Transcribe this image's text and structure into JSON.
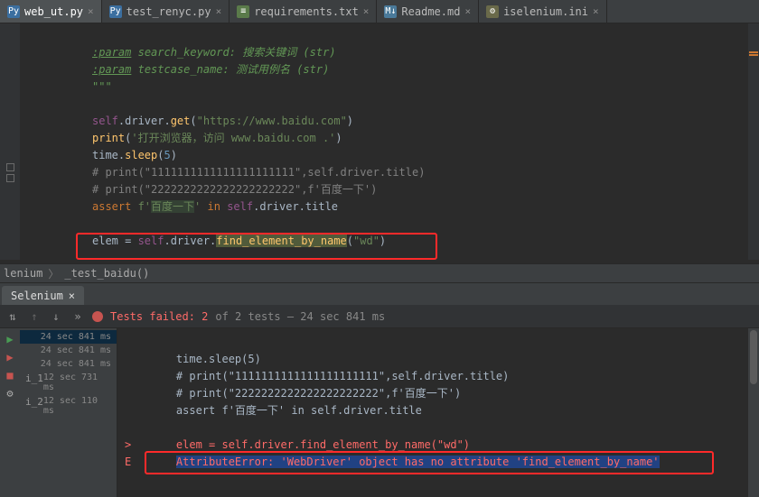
{
  "tabs": [
    {
      "label": "web_ut.py",
      "icon": "py",
      "active": true
    },
    {
      "label": "test_renyc.py",
      "icon": "py"
    },
    {
      "label": "requirements.txt",
      "icon": "txt"
    },
    {
      "label": "Readme.md",
      "icon": "md"
    },
    {
      "label": "iselenium.ini",
      "icon": "ini"
    }
  ],
  "code": {
    "l1_tag": ":param",
    "l1_key": "search_keyword:",
    "l1_desc": "搜索关键词 (str)",
    "l2_tag": ":param",
    "l2_key": "testcase_name:",
    "l2_desc": "测试用例名 (str)",
    "l3": "\"\"\"",
    "l5a": "self",
    "l5b": ".driver.",
    "l5c": "get",
    "l5d": "(",
    "l5e": "\"https://www.baidu.com\"",
    "l5f": ")",
    "l6a": "print",
    "l6b": "(",
    "l6c": "'打开浏览器，访问 www.baidu.com .'",
    "l6d": ")",
    "l7a": "time.",
    "l7b": "sleep",
    "l7c": "(",
    "l7d": "5",
    "l7e": ")",
    "l8": "# print(\"1111111111111111111111\",self.driver.title)",
    "l9": "# print(\"2222222222222222222222\",f'百度一下')",
    "l10a": "assert ",
    "l10b": "f'",
    "l10c": "百度一下",
    "l10d": "' ",
    "l10e": "in ",
    "l10f": "self",
    "l10g": ".driver.title",
    "l12a": "elem = ",
    "l12b": "self",
    "l12c": ".driver.",
    "l12d": "find_element_by_name",
    "l12e": "(",
    "l12f": "\"wd\"",
    "l12g": ")"
  },
  "breadcrumb": {
    "a": "lenium",
    "b": "_test_baidu()"
  },
  "panel_tab": "Selenium",
  "toolbar": {
    "fail_label": "Tests failed: 2",
    "sub": " of 2 tests – 24 sec 841 ms"
  },
  "tree": [
    {
      "label": "",
      "time": "24 sec 841 ms",
      "sel": true
    },
    {
      "label": "",
      "time": "24 sec 841 ms"
    },
    {
      "label": "",
      "time": "24 sec 841 ms"
    },
    {
      "label": "i_1",
      "time": "12 sec 731 ms"
    },
    {
      "label": "i_2",
      "time": "12 sec 110 ms"
    }
  ],
  "output": {
    "o1": "time.sleep(5)",
    "o2": "# print(\"1111111111111111111111\",self.driver.title)",
    "o3": "# print(\"2222222222222222222222\",f'百度一下')",
    "o4": "assert f'百度一下' in self.driver.title",
    "blank": "",
    "o5": "elem = self.driver.find_element_by_name(\"wd\")",
    "err": "AttributeError: 'WebDriver' object has no attribute 'find_element_by_name'",
    "mk_gt": ">",
    "mk_e": "E"
  }
}
